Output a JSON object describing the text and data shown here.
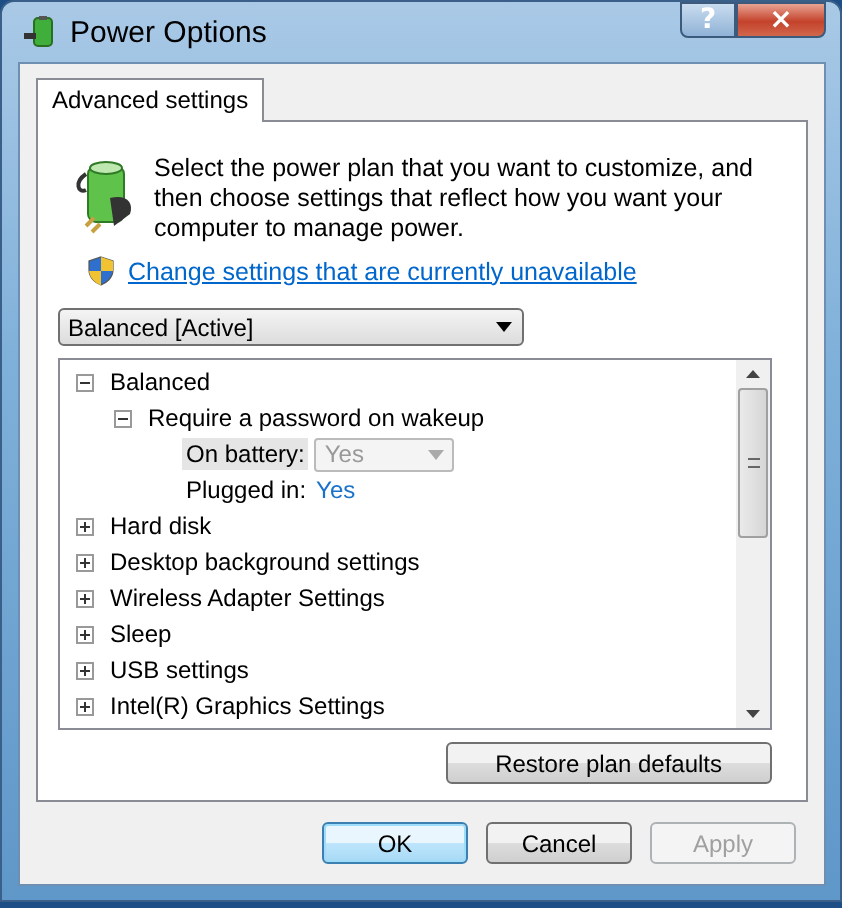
{
  "window": {
    "title": "Power Options",
    "help": "?",
    "close": "×"
  },
  "tabs": [
    {
      "label": "Advanced settings",
      "selected": true
    }
  ],
  "intro": {
    "text": "Select the power plan that you want to customize, and then choose settings that reflect how you want your computer to manage power.",
    "link": "Change settings that are currently unavailable"
  },
  "plan_select": {
    "value": "Balanced [Active]"
  },
  "tree": [
    {
      "label": "Balanced",
      "expanded": true,
      "children": [
        {
          "label": "Require a password on wakeup",
          "expanded": true,
          "values": [
            {
              "label": "On battery:",
              "value": "Yes",
              "kind": "dropdown",
              "disabled": true,
              "selected": true
            },
            {
              "label": "Plugged in:",
              "value": "Yes",
              "kind": "link",
              "disabled": false,
              "selected": false
            }
          ]
        }
      ]
    },
    {
      "label": "Hard disk",
      "expanded": false
    },
    {
      "label": "Desktop background settings",
      "expanded": false
    },
    {
      "label": "Wireless Adapter Settings",
      "expanded": false
    },
    {
      "label": "Sleep",
      "expanded": false
    },
    {
      "label": "USB settings",
      "expanded": false
    },
    {
      "label": "Intel(R) Graphics Settings",
      "expanded": false
    }
  ],
  "restore_button": "Restore plan defaults",
  "buttons": [
    {
      "label": "OK",
      "default": true,
      "disabled": false
    },
    {
      "label": "Cancel",
      "default": false,
      "disabled": false
    },
    {
      "label": "Apply",
      "default": false,
      "disabled": true
    }
  ]
}
